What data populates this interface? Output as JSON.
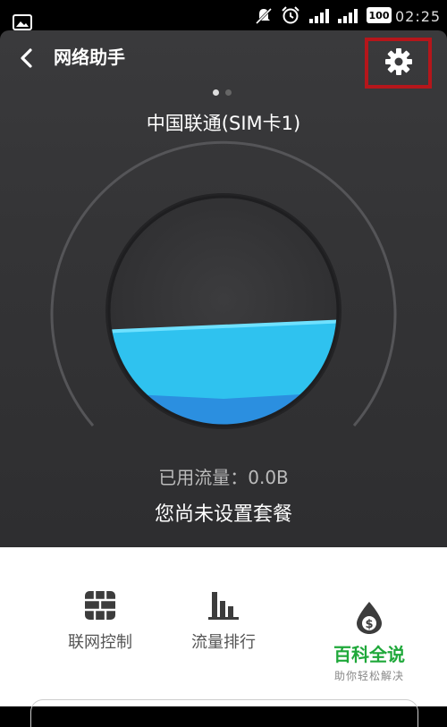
{
  "status_bar": {
    "battery": "100",
    "time": "02:25",
    "icons": [
      "image-icon",
      "mute-icon",
      "alarm-icon",
      "signal-icon",
      "signal-icon",
      "battery-icon"
    ]
  },
  "header": {
    "title": "网络助手",
    "back_icon": "chevron-left-icon",
    "settings_icon": "gear-icon"
  },
  "pager": {
    "pages": 2,
    "current": 1
  },
  "carrier": "中国联通(SIM卡1)",
  "gauge": {
    "fill_level": 0.45
  },
  "usage": {
    "used_text": "已用流量：0.0B",
    "plan_text": "您尚未设置套餐"
  },
  "tools": [
    {
      "label": "联网控制",
      "icon": "firewall-icon"
    },
    {
      "label": "流量排行",
      "icon": "bar-chart-icon"
    }
  ],
  "watermark": {
    "name": "百科全说",
    "subtitle": "助你轻松解决",
    "icon": "money-drop-icon"
  },
  "colors": {
    "panel_bg": "#343436",
    "water_light": "#2fc2ef",
    "water_dark": "#2b8fe0",
    "highlight_box": "#b5161b",
    "watermark_green": "#1fa83a"
  }
}
